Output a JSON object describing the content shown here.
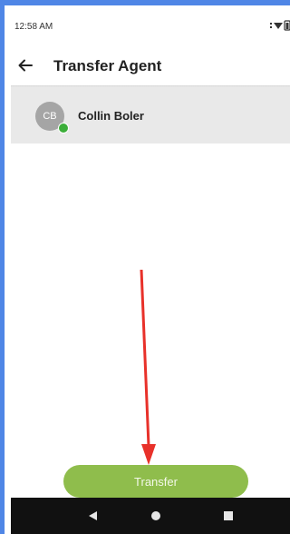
{
  "status_bar": {
    "time": "12:58 AM",
    "icons": [
      "signal-icon",
      "wifi-icon",
      "battery-icon"
    ]
  },
  "app_bar": {
    "back_icon": "arrow-left-icon",
    "title": "Transfer Agent"
  },
  "agents": [
    {
      "initials": "CB",
      "name": "Collin Boler",
      "presence_color": "#3cae3a"
    }
  ],
  "actions": {
    "transfer_label": "Transfer"
  },
  "nav_bar": {
    "buttons": [
      "back-triangle-icon",
      "home-circle-icon",
      "recents-square-icon"
    ]
  },
  "colors": {
    "frame": "#4f86e6",
    "button": "#8fbd4c",
    "annotation_arrow": "#e8312a",
    "list_background": "#e9e9e9"
  }
}
